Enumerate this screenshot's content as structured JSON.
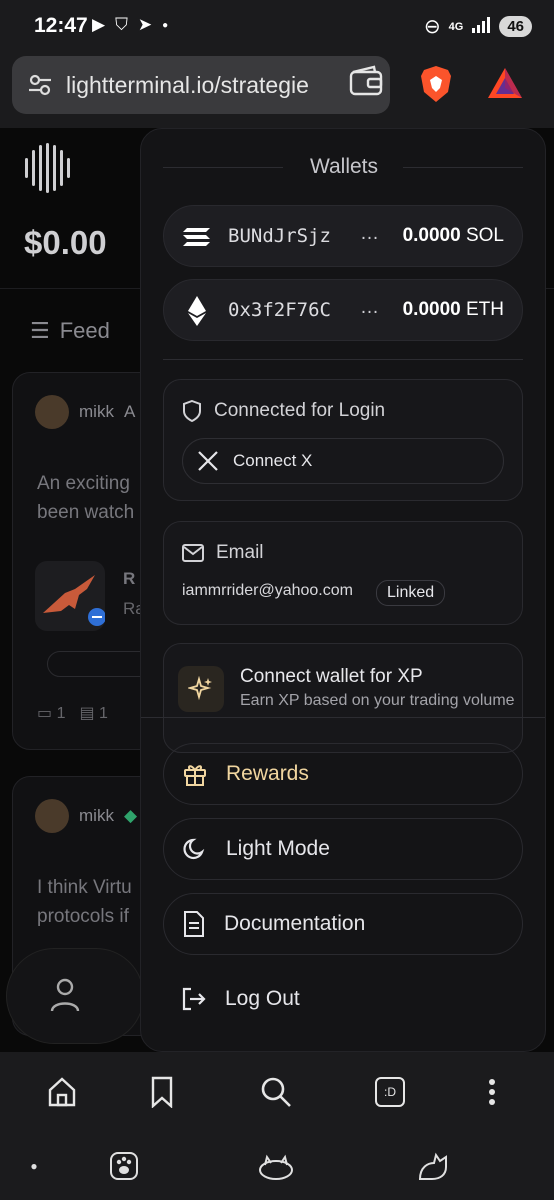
{
  "status": {
    "time": "12:47",
    "network": "4G",
    "battery": "46"
  },
  "browser": {
    "url": "lightterminal.io/strategie"
  },
  "page": {
    "balance": "$0.00",
    "feed_label": "Feed",
    "posts": [
      {
        "user": "mikk",
        "badge": "A",
        "text_lines": [
          "An exciting",
          "been watch"
        ],
        "token_symbol": "R",
        "token_sub": "Ra",
        "comments": "1",
        "docs": "1"
      },
      {
        "user": "mikk",
        "text_lines": [
          "I think Virtu",
          "protocols if"
        ]
      }
    ]
  },
  "panel": {
    "wallets_title": "Wallets",
    "wallets": [
      {
        "address": "BUNdJrSjz",
        "ellipsis": "…",
        "amount": "0.0000",
        "unit": "SOL",
        "icon": "solana-icon"
      },
      {
        "address": "0x3f2F76C",
        "ellipsis": "…",
        "amount": "0.0000",
        "unit": "ETH",
        "icon": "ethereum-icon"
      }
    ],
    "login": {
      "title": "Connected for Login",
      "connect_x": "Connect X"
    },
    "email": {
      "title": "Email",
      "address": "iammrrider@yahoo.com",
      "status": "Linked"
    },
    "xp": {
      "title": "Connect wallet for XP",
      "subtitle": "Earn XP based on your trading volume"
    },
    "menu": {
      "rewards": "Rewards",
      "light_mode": "Light Mode",
      "documentation": "Documentation",
      "logout": "Log Out"
    }
  },
  "bottom_nav": {
    "tabs_label": ":D"
  },
  "colors": {
    "accent_gold": "#f1d6a0",
    "panel_bg": "#141416"
  }
}
